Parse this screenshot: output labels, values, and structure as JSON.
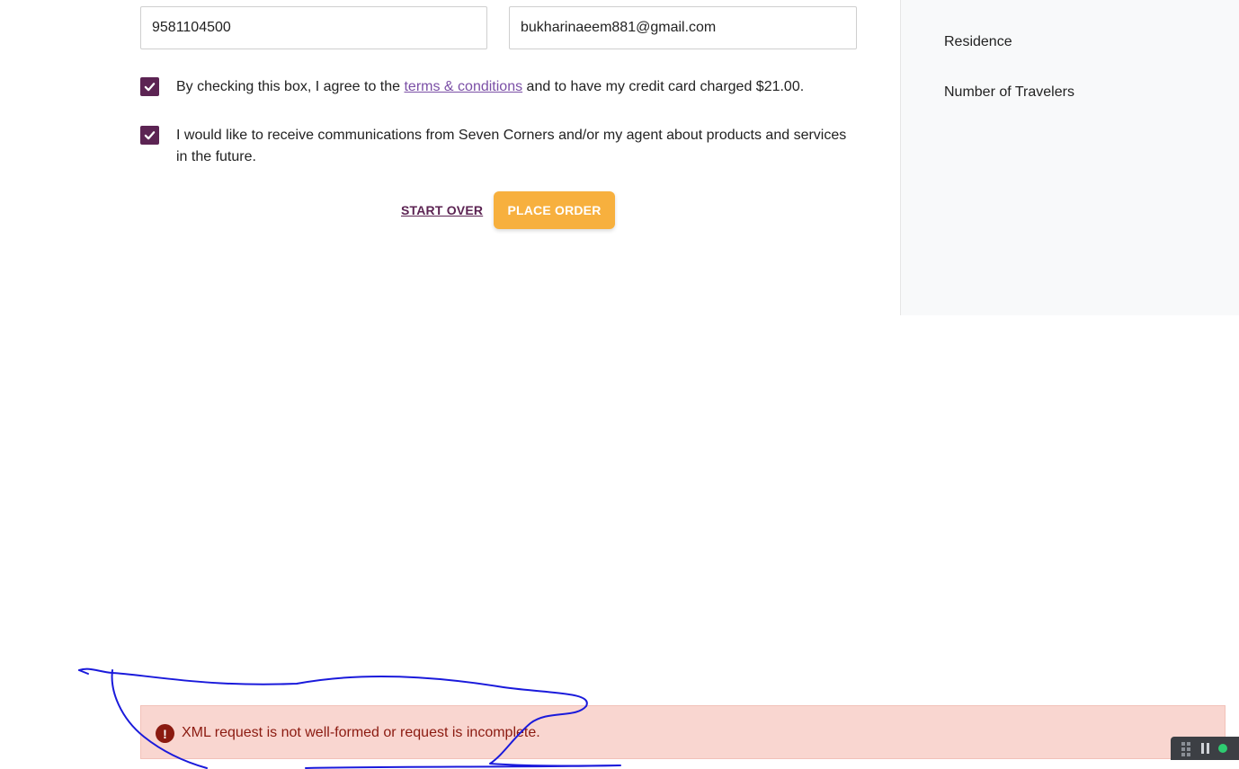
{
  "form": {
    "phone_value": "9581104500",
    "email_value": "bukharinaeem881@gmail.com"
  },
  "agreements": {
    "terms_prefix": "By checking this box, I agree to the ",
    "terms_link": "terms & conditions",
    "terms_suffix": " and to have my credit card charged $21.00.",
    "terms_checked": true,
    "comms_text": "I would like to receive communications from Seven Corners and/or my agent about products and services in the future.",
    "comms_checked": true
  },
  "actions": {
    "start_over_label": "START OVER",
    "place_order_label": "PLACE ORDER"
  },
  "sidebar": {
    "items": [
      {
        "label": "Residence"
      },
      {
        "label": "Number of Travelers"
      }
    ]
  },
  "error": {
    "icon_glyph": "!",
    "message": "XML request is not well-formed or request is incomplete."
  },
  "colors": {
    "brand_purple": "#5c2453",
    "link_purple": "#7b4fa6",
    "cta_orange": "#f7b03e",
    "error_bg": "#f9d6d0",
    "error_text": "#8b1a10",
    "annotation_blue": "#1a1adb"
  }
}
